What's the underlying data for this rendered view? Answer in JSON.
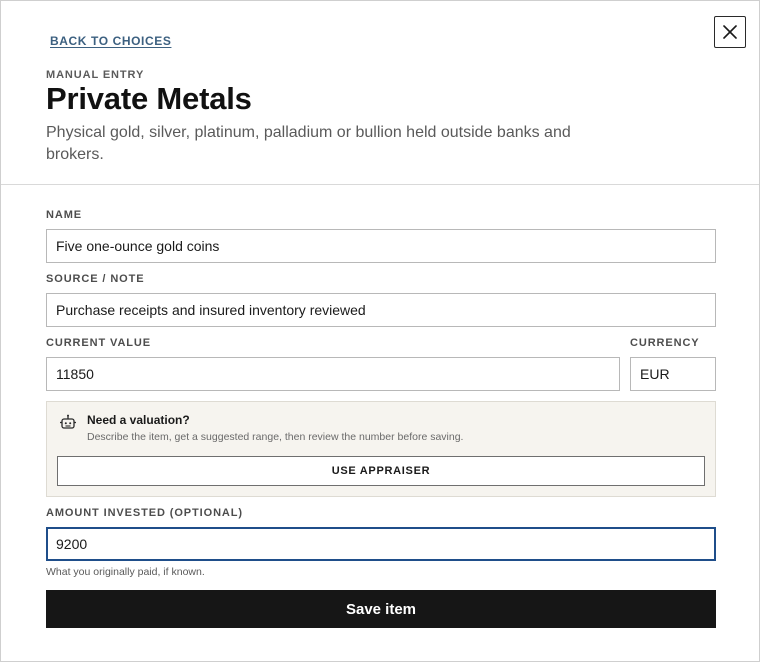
{
  "header": {
    "back_link": "BACK TO CHOICES",
    "eyebrow": "MANUAL ENTRY",
    "title": "Private Metals",
    "subtitle": "Physical gold, silver, platinum, palladium or bullion held outside banks and brokers."
  },
  "form": {
    "name": {
      "label": "NAME",
      "value": "Five one-ounce gold coins"
    },
    "source_note": {
      "label": "SOURCE / NOTE",
      "value": "Purchase receipts and insured inventory reviewed"
    },
    "current_value": {
      "label": "CURRENT VALUE",
      "value": "11850"
    },
    "currency": {
      "label": "CURRENCY",
      "value": "EUR"
    },
    "appraiser": {
      "title": "Need a valuation?",
      "description": "Describe the item, get a suggested range, then review the number before saving.",
      "button": "USE APPRAISER"
    },
    "amount_invested": {
      "label": "AMOUNT INVESTED (OPTIONAL)",
      "value": "9200",
      "hint": "What you originally paid, if known."
    },
    "save_button": "Save item"
  },
  "colors": {
    "link": "#3c6080",
    "focus_border": "#1f4e8a",
    "primary_button": "#161616",
    "panel_bg": "#f6f4ef"
  },
  "icons": {
    "close": "close-icon",
    "appraiser": "robot-icon"
  }
}
